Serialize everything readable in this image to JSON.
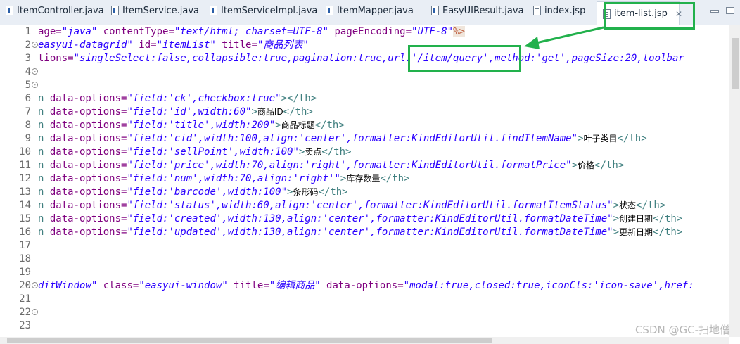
{
  "tabs": [
    {
      "label": "ItemController.java",
      "type": "java"
    },
    {
      "label": "ItemService.java",
      "type": "java"
    },
    {
      "label": "ItemServiceImpl.java",
      "type": "java"
    },
    {
      "label": "ItemMapper.java",
      "type": "java"
    },
    {
      "label": "EasyUIResult.java",
      "type": "java"
    },
    {
      "label": "index.jsp",
      "type": "jsp"
    },
    {
      "label": "item-list.jsp",
      "type": "jsp",
      "active": true,
      "close": "✕"
    }
  ],
  "lines": [
    {
      "n": "1",
      "parts": [
        [
          "attr",
          "age="
        ],
        [
          "str",
          "\"java\""
        ],
        [
          "attr",
          " contentType="
        ],
        [
          "str",
          "\"text/html; charset=UTF-8\""
        ],
        [
          "attr",
          " pageEncoding="
        ],
        [
          "str",
          "\"UTF-8\""
        ],
        [
          "pct",
          "%>"
        ]
      ]
    },
    {
      "n": "2",
      "fold": "-",
      "parts": [
        [
          "str",
          "easyui-datagrid\""
        ],
        [
          "attr",
          " id="
        ],
        [
          "str",
          "\"itemList\""
        ],
        [
          "attr",
          " title="
        ],
        [
          "str",
          "\"商品列表\""
        ]
      ]
    },
    {
      "n": "3",
      "parts": [
        [
          "attr",
          "tions="
        ],
        [
          "str",
          "\"singleSelect:false,collapsible:true,pagination:true,url:'/item/query',method:'get',pageSize:20,toolbar"
        ]
      ]
    },
    {
      "n": "4",
      "fold": "-",
      "parts": []
    },
    {
      "n": "5",
      "fold": "-",
      "parts": []
    },
    {
      "n": "6",
      "parts": [
        [
          "tag",
          "n "
        ],
        [
          "attr",
          "data-options="
        ],
        [
          "str",
          "\"field:'ck',checkbox:true\""
        ],
        [
          "tag",
          "></th>"
        ]
      ]
    },
    {
      "n": "7",
      "parts": [
        [
          "tag",
          "n "
        ],
        [
          "attr",
          "data-options="
        ],
        [
          "str",
          "\"field:'id',width:60\""
        ],
        [
          "tag",
          ">"
        ],
        [
          "txt",
          "商品ID"
        ],
        [
          "tag",
          "</th>"
        ]
      ]
    },
    {
      "n": "8",
      "parts": [
        [
          "tag",
          "n "
        ],
        [
          "attr",
          "data-options="
        ],
        [
          "str",
          "\"field:'title',width:200\""
        ],
        [
          "tag",
          ">"
        ],
        [
          "txt",
          "商品标题"
        ],
        [
          "tag",
          "</th>"
        ]
      ]
    },
    {
      "n": "9",
      "parts": [
        [
          "tag",
          "n "
        ],
        [
          "attr",
          "data-options="
        ],
        [
          "str",
          "\"field:'cid',width:100,align:'center',formatter:KindEditorUtil.findItemName\""
        ],
        [
          "tag",
          ">"
        ],
        [
          "txt",
          "叶子类目"
        ],
        [
          "tag",
          "</th>"
        ]
      ]
    },
    {
      "n": "10",
      "parts": [
        [
          "tag",
          "n "
        ],
        [
          "attr",
          "data-options="
        ],
        [
          "str",
          "\"field:'sellPoint',width:100\""
        ],
        [
          "tag",
          ">"
        ],
        [
          "txt",
          "卖点"
        ],
        [
          "tag",
          "</th>"
        ]
      ]
    },
    {
      "n": "11",
      "parts": [
        [
          "tag",
          "n "
        ],
        [
          "attr",
          "data-options="
        ],
        [
          "str",
          "\"field:'price',width:70,align:'right',formatter:KindEditorUtil.formatPrice\""
        ],
        [
          "tag",
          ">"
        ],
        [
          "txt",
          "价格"
        ],
        [
          "tag",
          "</th>"
        ]
      ]
    },
    {
      "n": "12",
      "parts": [
        [
          "tag",
          "n "
        ],
        [
          "attr",
          "data-options="
        ],
        [
          "str",
          "\"field:'num',width:70,align:'right'\""
        ],
        [
          "tag",
          ">"
        ],
        [
          "txt",
          "库存数量"
        ],
        [
          "tag",
          "</th>"
        ]
      ]
    },
    {
      "n": "13",
      "parts": [
        [
          "tag",
          "n "
        ],
        [
          "attr",
          "data-options="
        ],
        [
          "str",
          "\"field:'barcode',width:100\""
        ],
        [
          "tag",
          ">"
        ],
        [
          "txt",
          "条形码"
        ],
        [
          "tag",
          "</th>"
        ]
      ]
    },
    {
      "n": "14",
      "parts": [
        [
          "tag",
          "n "
        ],
        [
          "attr",
          "data-options="
        ],
        [
          "str",
          "\"field:'status',width:60,align:'center',formatter:KindEditorUtil.formatItemStatus\""
        ],
        [
          "tag",
          ">"
        ],
        [
          "txt",
          "状态"
        ],
        [
          "tag",
          "</th>"
        ]
      ]
    },
    {
      "n": "15",
      "parts": [
        [
          "tag",
          "n "
        ],
        [
          "attr",
          "data-options="
        ],
        [
          "str",
          "\"field:'created',width:130,align:'center',formatter:KindEditorUtil.formatDateTime\""
        ],
        [
          "tag",
          ">"
        ],
        [
          "txt",
          "创建日期"
        ],
        [
          "tag",
          "</th>"
        ]
      ]
    },
    {
      "n": "16",
      "parts": [
        [
          "tag",
          "n "
        ],
        [
          "attr",
          "data-options="
        ],
        [
          "str",
          "\"field:'updated',width:130,align:'center',formatter:KindEditorUtil.formatDateTime\""
        ],
        [
          "tag",
          ">"
        ],
        [
          "txt",
          "更新日期"
        ],
        [
          "tag",
          "</th>"
        ]
      ]
    },
    {
      "n": "17",
      "parts": []
    },
    {
      "n": "18",
      "parts": []
    },
    {
      "n": "19",
      "parts": []
    },
    {
      "n": "20",
      "fold": "-",
      "parts": [
        [
          "str",
          "ditWindow\""
        ],
        [
          "attr",
          " class="
        ],
        [
          "str",
          "\"easyui-window\""
        ],
        [
          "attr",
          " title="
        ],
        [
          "str",
          "\"编辑商品\""
        ],
        [
          "attr",
          " data-options="
        ],
        [
          "str",
          "\"modal:true,closed:true,iconCls:'icon-save',href:"
        ]
      ]
    },
    {
      "n": "21",
      "parts": []
    },
    {
      "n": "22",
      "fold": "-",
      "parts": []
    },
    {
      "n": "23",
      "parts": []
    }
  ],
  "watermark": "CSDN @GC-扫地僧"
}
